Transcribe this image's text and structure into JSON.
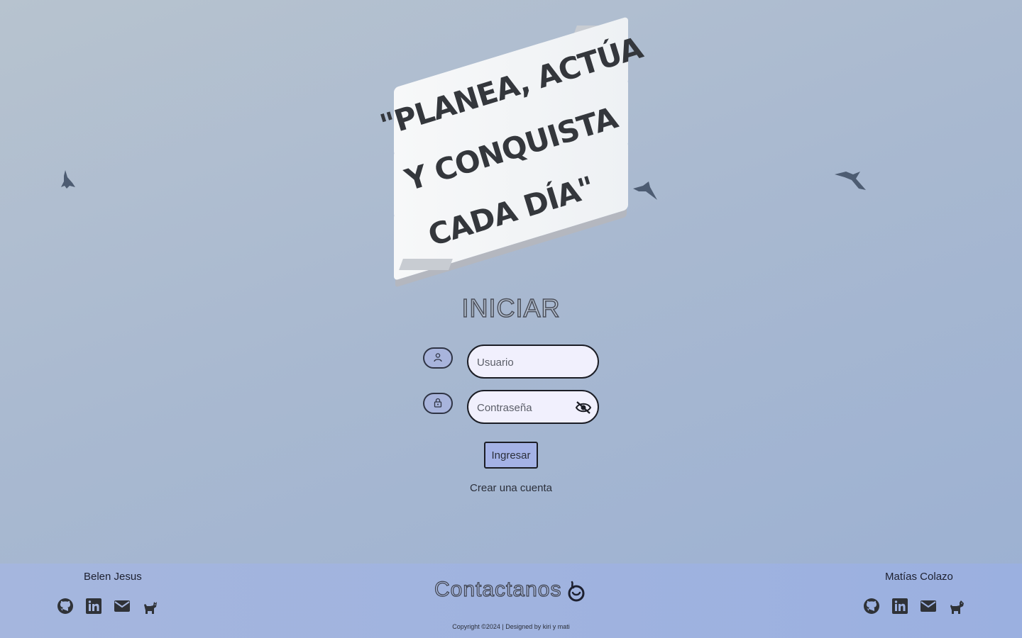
{
  "banner": {
    "line1": "\"PLANEA, ACTÚA",
    "line2": "Y CONQUISTA",
    "line3": "CADA DÍA\""
  },
  "form": {
    "title": "INICIAR",
    "user_icon": "user-icon",
    "lock_icon": "lock-icon",
    "username_placeholder": "Usuario",
    "password_placeholder": "Contraseña",
    "toggle_icon": "eye-off-icon",
    "submit_label": "Ingresar",
    "register_link": "Crear una cuenta"
  },
  "footer": {
    "left_name": "Belen Jesus",
    "right_name": "Matías Colazo",
    "contact_title": "Contactanos",
    "copyright": "Copyright ©2024 | Designed by kiri y mati",
    "social_icons": [
      "github-icon",
      "linkedin-icon",
      "mail-icon",
      "pet-icon"
    ]
  },
  "colors": {
    "background_start": "#b7c3cf",
    "background_end": "#9bb0d3",
    "field_bg": "#f1f0fd",
    "button_bg": "#a4b2e6",
    "footer_bg": "#a5b6de"
  }
}
